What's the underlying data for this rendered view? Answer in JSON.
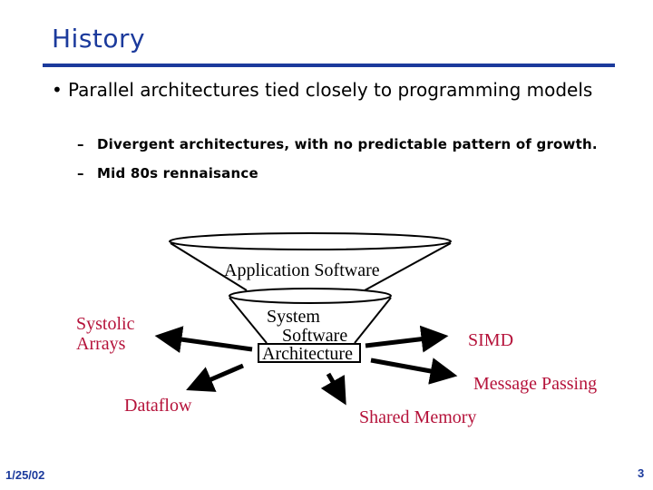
{
  "slide": {
    "title": "History",
    "bullet": {
      "marker": "•",
      "text": "Parallel architectures tied closely to programming models"
    },
    "sub_bullets": [
      {
        "marker": "–",
        "text": "Divergent architectures, with no predictable  pattern of growth."
      },
      {
        "marker": "–",
        "text": "Mid 80s rennaisance"
      }
    ],
    "diagram": {
      "layers": {
        "application": "Application Software",
        "system_line1": "System",
        "system_line2": "Software",
        "architecture": "Architecture"
      },
      "branches": {
        "systolic_line1": "Systolic",
        "systolic_line2": "Arrays",
        "dataflow": "Dataflow",
        "simd": "SIMD",
        "message_passing": "Message Passing",
        "shared_memory": "Shared Memory"
      },
      "colors": {
        "branch_label": "#b5123a",
        "structure": "#000000"
      }
    },
    "footer": {
      "date": "1/25/02",
      "page_number": "3"
    },
    "colors": {
      "title": "#1b3a9c",
      "rule": "#1b3a9c"
    }
  }
}
